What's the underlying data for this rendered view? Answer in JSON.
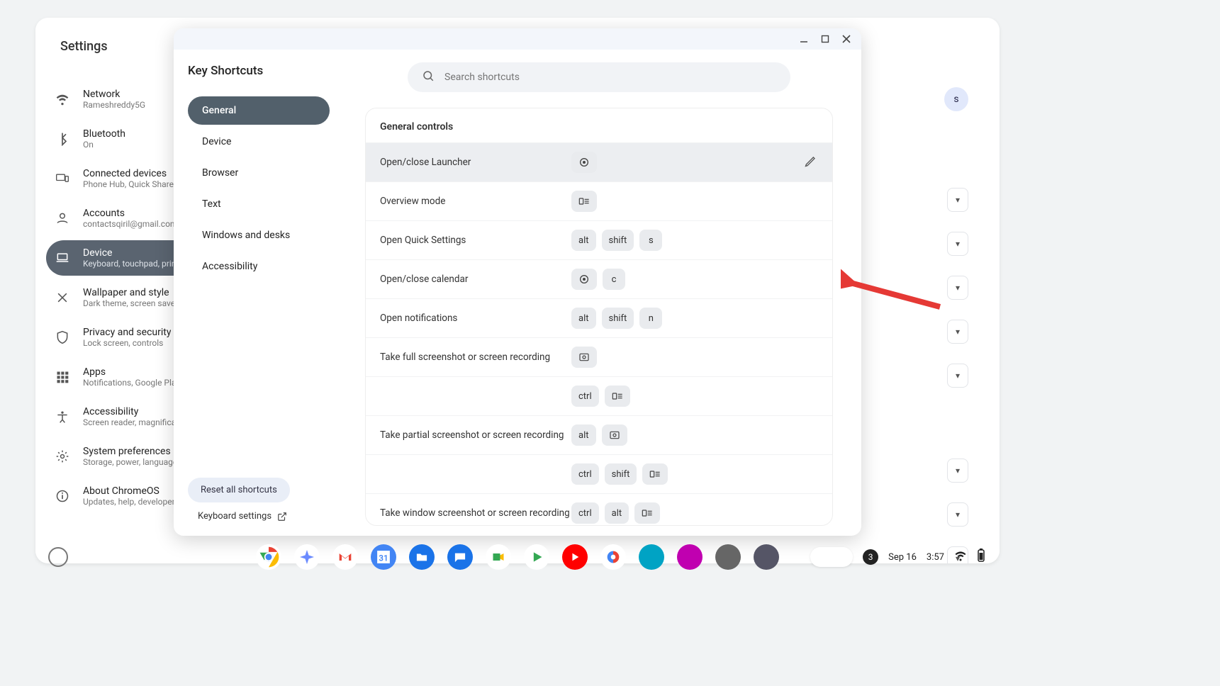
{
  "settings": {
    "title": "Settings",
    "sidebar": [
      {
        "icon": "wifi",
        "title": "Network",
        "sub": "Rameshreddy5G"
      },
      {
        "icon": "bluetooth",
        "title": "Bluetooth",
        "sub": "On"
      },
      {
        "icon": "devices",
        "title": "Connected devices",
        "sub": "Phone Hub, Quick Share"
      },
      {
        "icon": "account",
        "title": "Accounts",
        "sub": "contactsqiril@gmail.com"
      },
      {
        "icon": "laptop",
        "title": "Device",
        "sub": "Keyboard, touchpad, print"
      },
      {
        "icon": "palette",
        "title": "Wallpaper and style",
        "sub": "Dark theme, screen saver"
      },
      {
        "icon": "shield",
        "title": "Privacy and security",
        "sub": "Lock screen, controls"
      },
      {
        "icon": "apps",
        "title": "Apps",
        "sub": "Notifications, Google Play"
      },
      {
        "icon": "a11y",
        "title": "Accessibility",
        "sub": "Screen reader, magnification"
      },
      {
        "icon": "gear",
        "title": "System preferences",
        "sub": "Storage, power, language"
      },
      {
        "icon": "info",
        "title": "About ChromeOS",
        "sub": "Updates, help, developer o"
      }
    ],
    "active_sidebar_index": 4
  },
  "shortcuts_window": {
    "title": "Key Shortcuts",
    "search_placeholder": "Search shortcuts",
    "categories": [
      "General",
      "Device",
      "Browser",
      "Text",
      "Windows and desks",
      "Accessibility"
    ],
    "active_category_index": 0,
    "reset_label": "Reset all shortcuts",
    "keyboard_settings_label": "Keyboard settings",
    "section_heading": "General controls",
    "rows": [
      {
        "label": "Open/close Launcher",
        "keys": [
          {
            "t": "icon",
            "v": "launcher"
          }
        ],
        "highlight": true,
        "edit": true
      },
      {
        "label": "Overview mode",
        "keys": [
          {
            "t": "icon",
            "v": "overview"
          }
        ]
      },
      {
        "label": "Open Quick Settings",
        "keys": [
          {
            "t": "txt",
            "v": "alt"
          },
          {
            "t": "txt",
            "v": "shift"
          },
          {
            "t": "txt",
            "v": "s"
          }
        ]
      },
      {
        "label": "Open/close calendar",
        "keys": [
          {
            "t": "icon",
            "v": "launcher"
          },
          {
            "t": "txt",
            "v": "c"
          }
        ]
      },
      {
        "label": "Open notifications",
        "keys": [
          {
            "t": "txt",
            "v": "alt"
          },
          {
            "t": "txt",
            "v": "shift"
          },
          {
            "t": "txt",
            "v": "n"
          }
        ]
      },
      {
        "label": "Take full screenshot or screen recording",
        "keys": [
          {
            "t": "icon",
            "v": "screenshot"
          }
        ]
      },
      {
        "label": "",
        "keys": [
          {
            "t": "txt",
            "v": "ctrl"
          },
          {
            "t": "icon",
            "v": "overview"
          }
        ]
      },
      {
        "label": "Take partial screenshot or screen recording",
        "keys": [
          {
            "t": "txt",
            "v": "alt"
          },
          {
            "t": "icon",
            "v": "screenshot"
          }
        ]
      },
      {
        "label": "",
        "keys": [
          {
            "t": "txt",
            "v": "ctrl"
          },
          {
            "t": "txt",
            "v": "shift"
          },
          {
            "t": "icon",
            "v": "overview"
          }
        ]
      },
      {
        "label": "Take window screenshot or screen recording",
        "keys": [
          {
            "t": "txt",
            "v": "ctrl"
          },
          {
            "t": "txt",
            "v": "alt"
          },
          {
            "t": "icon",
            "v": "overview"
          }
        ]
      }
    ]
  },
  "bg_chip": "s",
  "shelf": {
    "apps": [
      {
        "name": "chrome",
        "color": "#fff"
      },
      {
        "name": "gemini",
        "color": "#fff"
      },
      {
        "name": "gmail",
        "color": "#fff"
      },
      {
        "name": "calendar",
        "color": "#4285f4"
      },
      {
        "name": "files",
        "color": "#1a73e8"
      },
      {
        "name": "messages",
        "color": "#1a73e8"
      },
      {
        "name": "meet",
        "color": "#fff"
      },
      {
        "name": "play",
        "color": "#fff"
      },
      {
        "name": "youtube",
        "color": "#ff0000"
      },
      {
        "name": "photos",
        "color": "#fff"
      },
      {
        "name": "app1",
        "color": "#00a3c4"
      },
      {
        "name": "app2",
        "color": "#c000b0"
      },
      {
        "name": "settings",
        "color": "#666"
      },
      {
        "name": "app3",
        "color": "#556"
      }
    ],
    "tray": {
      "badge": "3",
      "date": "Sep 16",
      "time": "3:57"
    }
  }
}
